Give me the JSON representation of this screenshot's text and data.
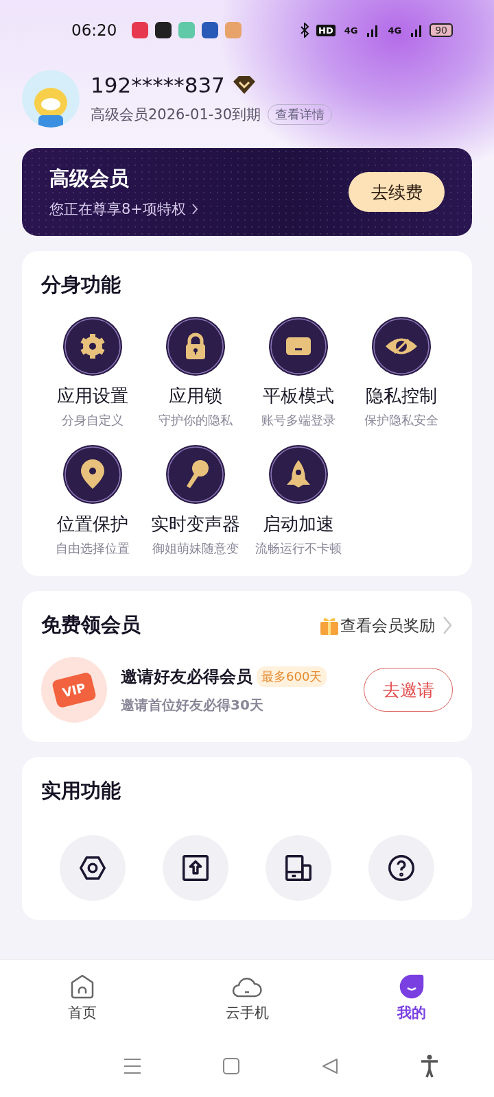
{
  "status_bar": {
    "time": "06:20",
    "network_badges": [
      "HD",
      "4G",
      "4G"
    ],
    "battery": "90"
  },
  "profile": {
    "phone": "192*****837",
    "membership": "高级会员2026-01-30到期",
    "details_button": "查看详情"
  },
  "member_card": {
    "title": "高级会员",
    "subtitle": "您正在尊享8+项特权",
    "button": "去续费"
  },
  "clone_features": {
    "title": "分身功能",
    "items": [
      {
        "title": "应用设置",
        "subtitle": "分身自定义"
      },
      {
        "title": "应用锁",
        "subtitle": "守护你的隐私"
      },
      {
        "title": "平板模式",
        "subtitle": "账号多端登录"
      },
      {
        "title": "隐私控制",
        "subtitle": "保护隐私安全"
      },
      {
        "title": "位置保护",
        "subtitle": "自由选择位置"
      },
      {
        "title": "实时变声器",
        "subtitle": "御姐萌妹随意变"
      },
      {
        "title": "启动加速",
        "subtitle": "流畅运行不卡顿"
      }
    ]
  },
  "free_membership": {
    "title": "免费领会员",
    "rewards_link": "查看会员奖励",
    "invite": {
      "vip_badge": "VIP",
      "title": "邀请好友必得会员",
      "tag": "最多600天",
      "subtitle": "邀请首位好友必得30天",
      "button": "去邀请"
    }
  },
  "tools": {
    "title": "实用功能"
  },
  "tab_bar": [
    {
      "label": "首页",
      "selected": false
    },
    {
      "label": "云手机",
      "selected": false
    },
    {
      "label": "我的",
      "selected": true
    }
  ]
}
